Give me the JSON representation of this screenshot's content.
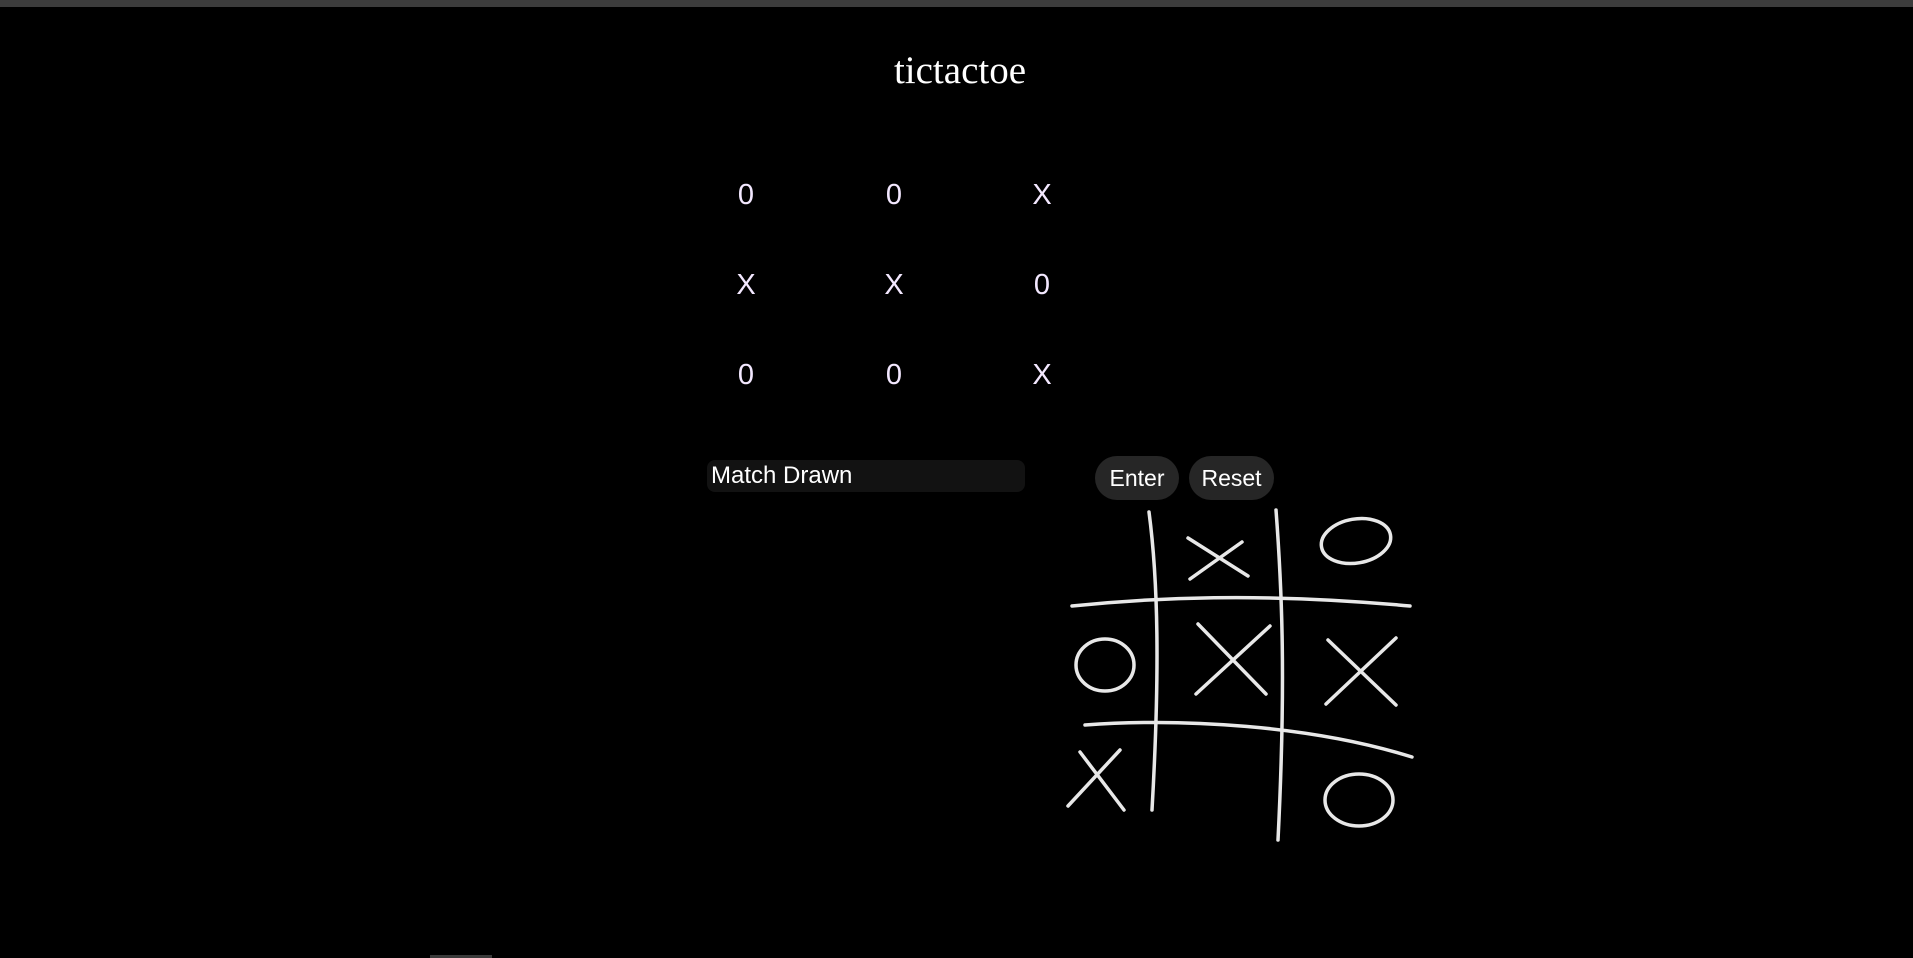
{
  "page": {
    "title": "tictactoe"
  },
  "board": {
    "cells": [
      "0",
      "0",
      "X",
      "X",
      "X",
      "0",
      "0",
      "0",
      "X"
    ]
  },
  "status": {
    "value": "Match Drawn"
  },
  "controls": {
    "enter_label": "Enter",
    "reset_label": "Reset"
  },
  "illustration": {
    "icon": "tic-tac-toe-sketch-icon",
    "stroke_color": "#e8e8e8"
  },
  "colors": {
    "background": "#000000",
    "cell_text": "#f3e8ff",
    "button_bg": "#262626"
  }
}
